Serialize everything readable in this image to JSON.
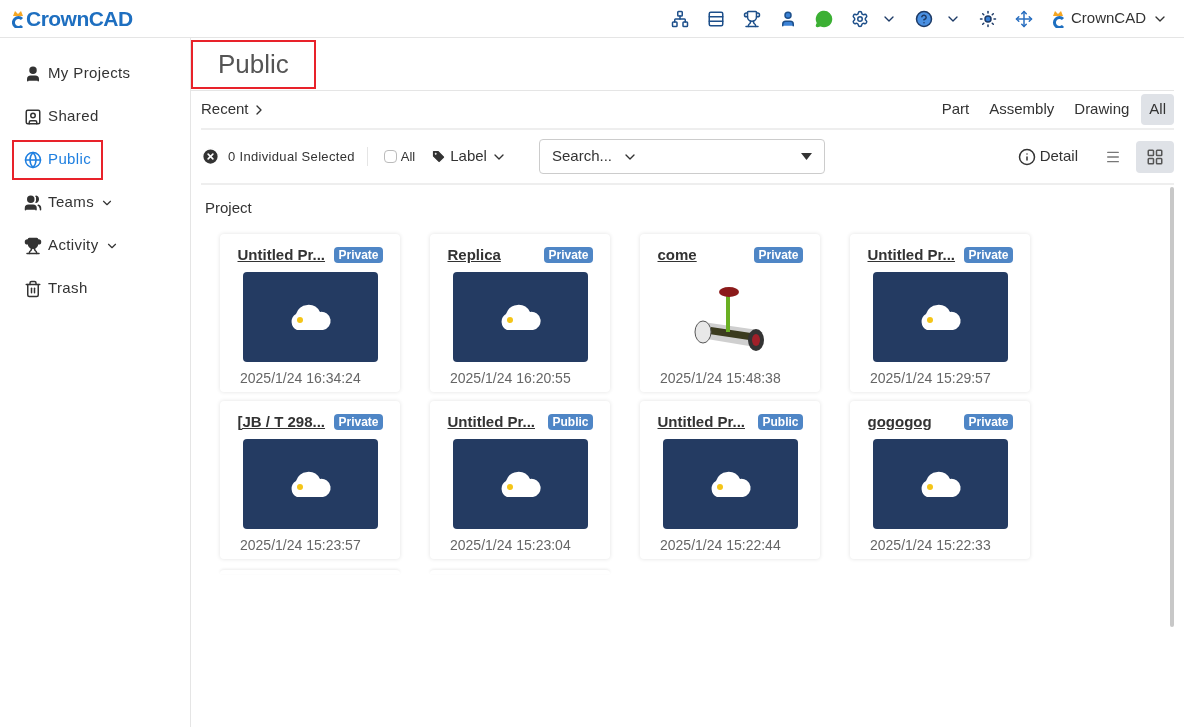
{
  "header": {
    "logo": "CrownCAD",
    "user": "CrownCAD"
  },
  "sidebar": {
    "items": [
      {
        "kind": "user",
        "label": "My Projects",
        "selected": false,
        "expandable": false
      },
      {
        "kind": "shared",
        "label": "Shared",
        "selected": false,
        "expandable": false
      },
      {
        "kind": "globe",
        "label": "Public",
        "selected": true,
        "expandable": false
      },
      {
        "kind": "team",
        "label": "Teams",
        "selected": false,
        "expandable": true
      },
      {
        "kind": "trophy",
        "label": "Activity",
        "selected": false,
        "expandable": true
      },
      {
        "kind": "trash",
        "label": "Trash",
        "selected": false,
        "expandable": false
      }
    ]
  },
  "page_title": {
    "text": "Public",
    "highlighted": true
  },
  "recent": "Recent",
  "type_filters": [
    {
      "label": "Part",
      "selected": false
    },
    {
      "label": "Assembly",
      "selected": false
    },
    {
      "label": "Drawing",
      "selected": false
    },
    {
      "label": "All",
      "selected": true
    }
  ],
  "toolbar": {
    "selection": "0 Individual Selected",
    "select_all": {
      "label": "All",
      "checked": false
    },
    "label_menu": "Label",
    "search": {
      "placeholder": "Search..."
    },
    "detail": "Detail",
    "views": [
      {
        "kind": "list",
        "selected": false
      },
      {
        "kind": "grid",
        "selected": true
      }
    ]
  },
  "section": "Project",
  "cards": [
    {
      "title": "Untitled Pr...",
      "badge": "Private",
      "kind": "placeholder",
      "date": "2025/1/24 16:34:24"
    },
    {
      "title": "Replica",
      "badge": "Private",
      "kind": "placeholder",
      "date": "2025/1/24 16:20:55"
    },
    {
      "title": "come",
      "badge": "Private",
      "kind": "picture",
      "date": "2025/1/24 15:48:38"
    },
    {
      "title": "Untitled Pr...",
      "badge": "Private",
      "kind": "placeholder",
      "date": "2025/1/24 15:29:57"
    },
    {
      "title": "[JB / T 298...",
      "badge": "Private",
      "kind": "placeholder",
      "date": "2025/1/24 15:23:57"
    },
    {
      "title": "Untitled Pr...",
      "badge": "Public",
      "kind": "placeholder",
      "date": "2025/1/24 15:23:04"
    },
    {
      "title": "Untitled Pr...",
      "badge": "Public",
      "kind": "placeholder",
      "date": "2025/1/24 15:22:44"
    },
    {
      "title": "gogogog",
      "badge": "Private",
      "kind": "placeholder",
      "date": "2025/1/24 15:22:33"
    }
  ]
}
